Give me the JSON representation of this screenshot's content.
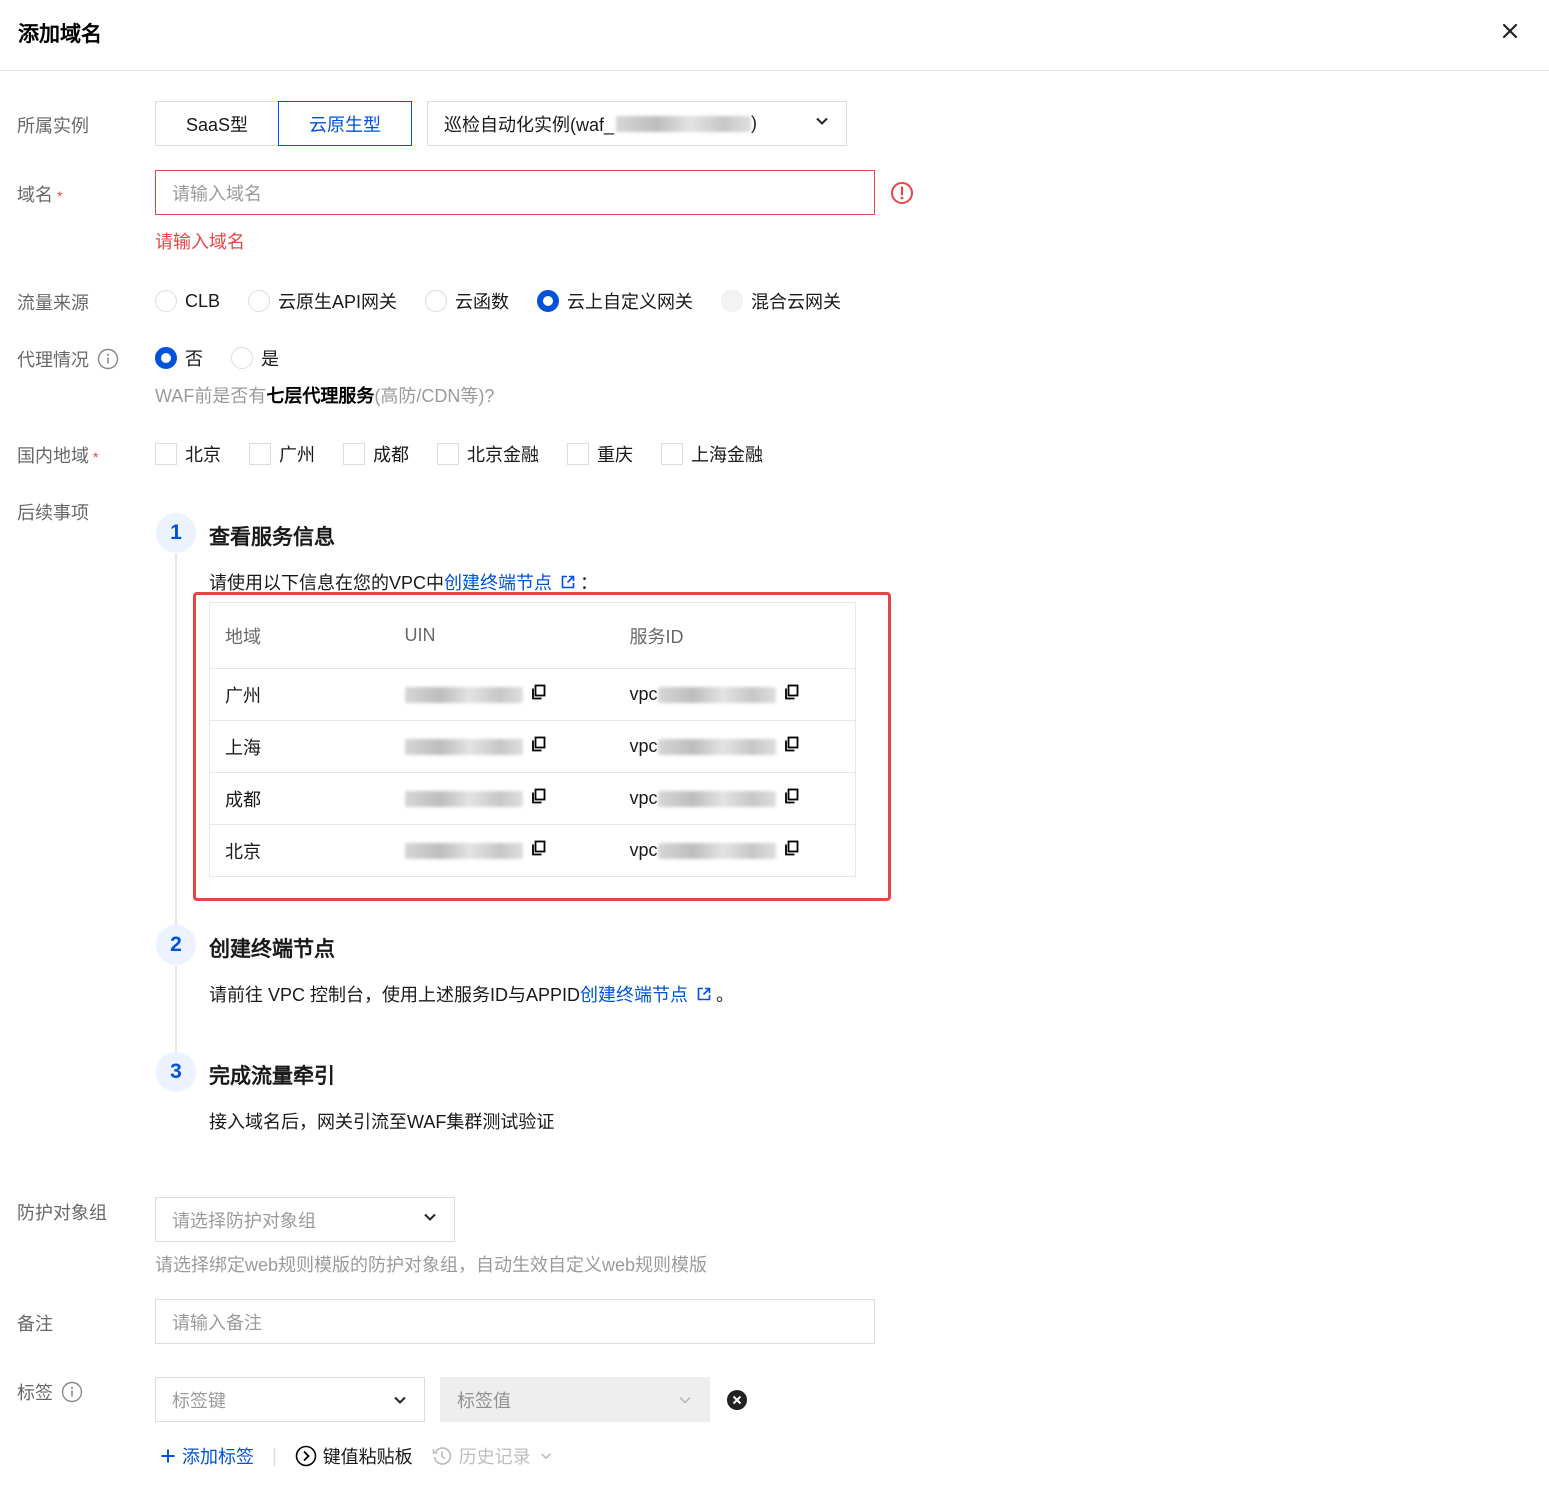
{
  "header": {
    "title": "添加域名"
  },
  "instance": {
    "label": "所属实例",
    "types": [
      "SaaS型",
      "云原生型"
    ],
    "selected_instance": "巡检自动化实例(waf_"
  },
  "domain": {
    "label": "域名",
    "required_mark": "*",
    "placeholder": "请输入域名",
    "error": "请输入域名"
  },
  "traffic": {
    "label": "流量来源",
    "options": [
      "CLB",
      "云原生API网关",
      "云函数",
      "云上自定义网关",
      "混合云网关"
    ],
    "selected": "云上自定义网关"
  },
  "proxy": {
    "label": "代理情况",
    "options": [
      "否",
      "是"
    ],
    "selected": "否",
    "hint_prefix": "WAF前是否有",
    "hint_bold": "七层代理服务",
    "hint_suffix": "(高防/CDN等)?"
  },
  "regions": {
    "label": "国内地域",
    "required_mark": "*",
    "options": [
      "北京",
      "广州",
      "成都",
      "北京金融",
      "重庆",
      "上海金融"
    ]
  },
  "followup": {
    "label": "后续事项",
    "steps": [
      {
        "num": "1",
        "title": "查看服务信息",
        "text_prefix": "请使用以下信息在您的VPC中",
        "link": "创建终端节点",
        "text_suffix": "："
      },
      {
        "num": "2",
        "title": "创建终端节点",
        "text_prefix": "请前往 VPC 控制台，使用上述服务ID与APPID",
        "link": "创建终端节点",
        "text_suffix": "。"
      },
      {
        "num": "3",
        "title": "完成流量牵引",
        "text": "接入域名后，网关引流至WAF集群测试验证"
      }
    ]
  },
  "service_table": {
    "headers": [
      "地域",
      "UIN",
      "服务ID"
    ],
    "rows": [
      {
        "region": "广州",
        "service_prefix": "vpc"
      },
      {
        "region": "上海",
        "service_prefix": "vpc"
      },
      {
        "region": "成都",
        "service_prefix": "vpc"
      },
      {
        "region": "北京",
        "service_prefix": "vpc"
      }
    ]
  },
  "protect_group": {
    "label": "防护对象组",
    "placeholder": "请选择防护对象组",
    "hint": "请选择绑定web规则模版的防护对象组，自动生效自定义web规则模版"
  },
  "remark": {
    "label": "备注",
    "placeholder": "请输入备注"
  },
  "tags": {
    "label": "标签",
    "key_placeholder": "标签键",
    "value_placeholder": "标签值",
    "add_label": "添加标签",
    "paste_label": "键值粘贴板",
    "history_label": "历史记录"
  },
  "colors": {
    "primary": "#0052d9",
    "error": "#e54545"
  }
}
